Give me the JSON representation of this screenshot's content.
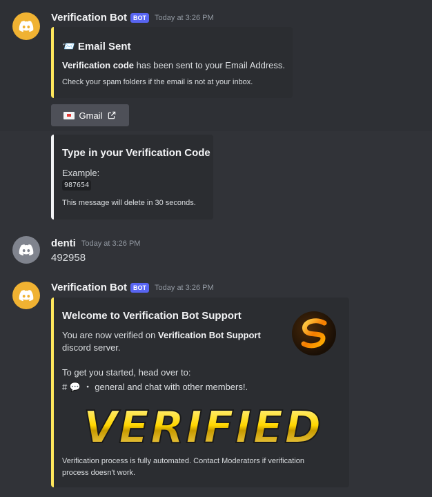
{
  "msg1": {
    "username": "Verification Bot",
    "bot_tag": "BOT",
    "timestamp": "Today at 3:26 PM",
    "embed_title": "📨 Email Sent",
    "embed_desc_bold": "Verification code",
    "embed_desc_rest": " has been sent to your Email Address.",
    "embed_footer": "Check your spam folders if the email is not at your inbox.",
    "button_label": "Gmail"
  },
  "msg2": {
    "title": "Type in your Verification Code",
    "example_label": "Example:",
    "example_code": "987654",
    "footer": "This message will delete in 30 seconds."
  },
  "msg3": {
    "username": "denti",
    "timestamp": "Today at 3:26 PM",
    "content": "492958"
  },
  "msg4": {
    "username": "Verification Bot",
    "bot_tag": "BOT",
    "timestamp": "Today at 3:26 PM",
    "title": "Welcome to Verification Bot Support",
    "line1_pre": "You are now verified on ",
    "line1_bold": "Verification Bot Support",
    "line2": "discord server.",
    "line3": "To get you started, head over to:",
    "line4": "# 💬 ・ general and chat with other members!.",
    "image_text": "VERIFIED",
    "footer1": "Verification process is fully automated. Contact Moderators if verification",
    "footer2": "process doesn't work."
  },
  "colors": {
    "background": "#313338",
    "embed_bg": "#2b2d31",
    "embed_accent": "#fee75c",
    "bot_tag": "#5865f2",
    "avatar_yellow": "#f0b232",
    "avatar_grey": "#80848e"
  }
}
